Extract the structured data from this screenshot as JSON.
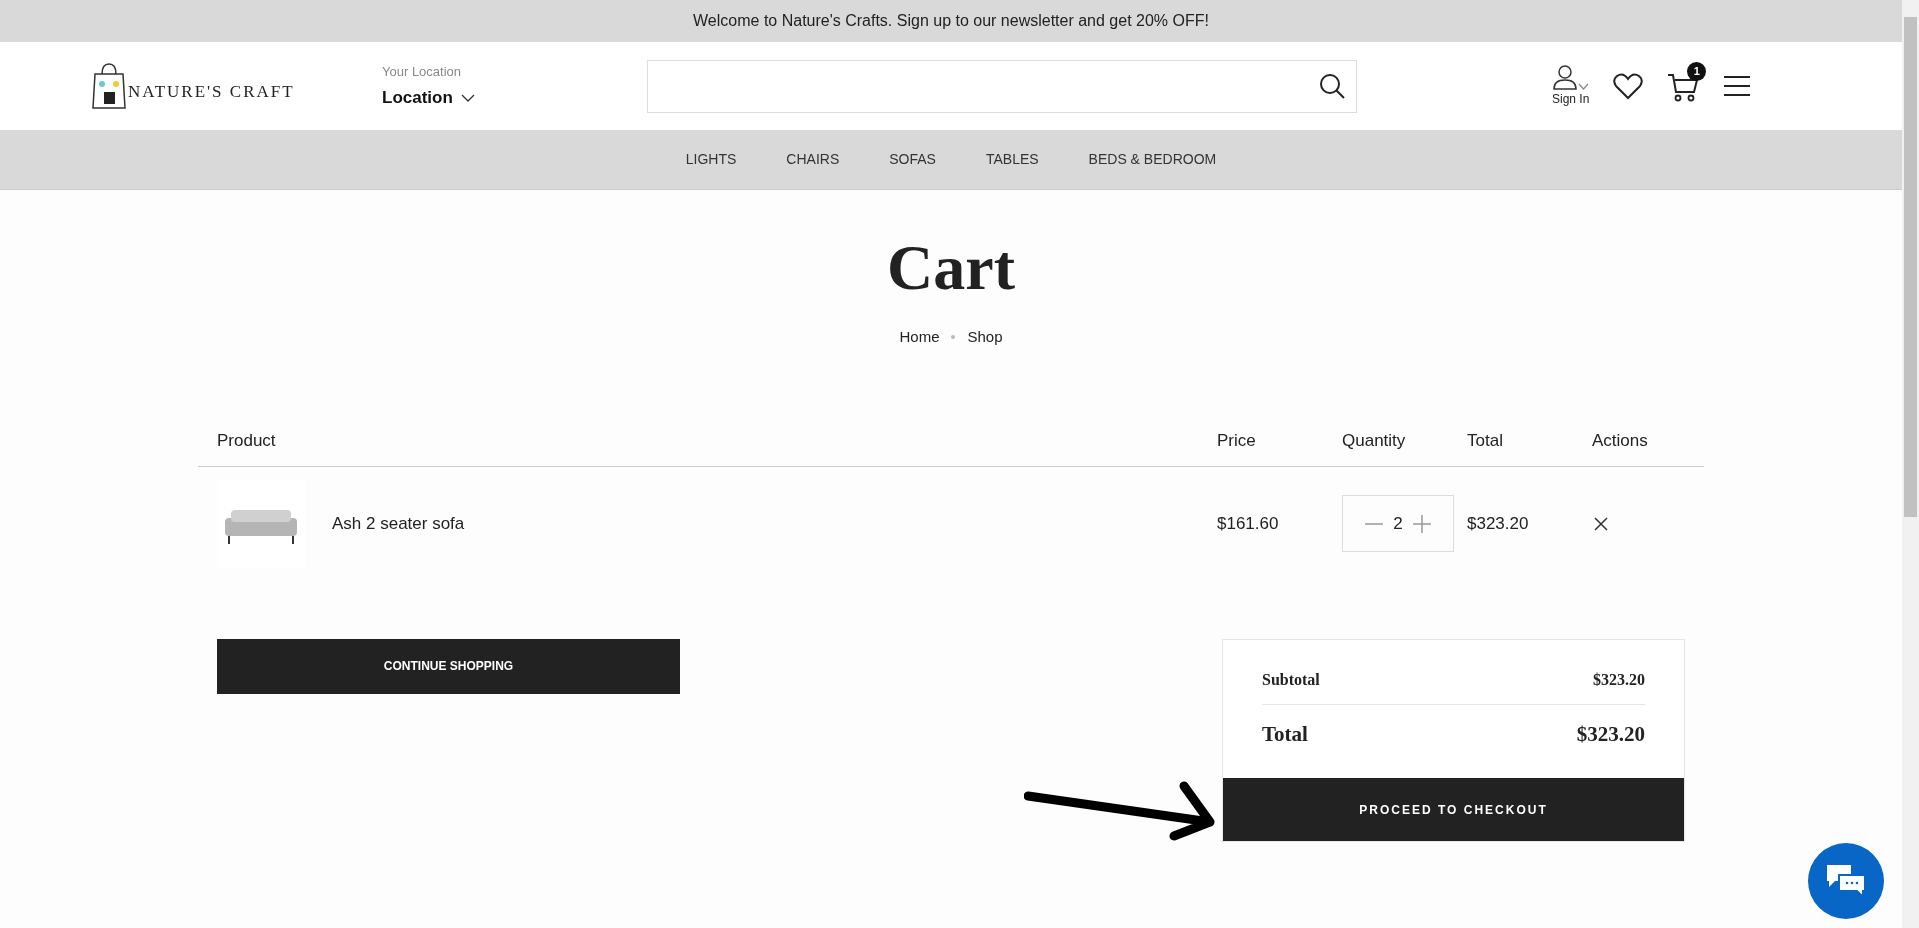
{
  "banner": {
    "text": "Welcome to Nature's Crafts. Sign up to our newsletter and get 20% OFF!"
  },
  "header": {
    "logo_text": "NATURE'S CRAFT",
    "location_label": "Your Location",
    "location_value": "Location",
    "sign_in": "Sign In",
    "cart_count": "1"
  },
  "nav": [
    "LIGHTS",
    "CHAIRS",
    "SOFAS",
    "TABLES",
    "BEDS & BEDROOM"
  ],
  "page_title": "Cart",
  "breadcrumb": [
    "Home",
    "Shop"
  ],
  "table": {
    "columns": [
      "Product",
      "Price",
      "Quantity",
      "Total",
      "Actions"
    ],
    "rows": [
      {
        "product": "Ash 2 seater sofa",
        "price": "$161.60",
        "quantity": "2",
        "total": "$323.20"
      }
    ]
  },
  "continue_button": "CONTINUE SHOPPING",
  "summary": {
    "subtotal_label": "Subtotal",
    "subtotal": "$323.20",
    "total_label": "Total",
    "total": "$323.20",
    "checkout_button": "PROCEED TO CHECKOUT"
  }
}
